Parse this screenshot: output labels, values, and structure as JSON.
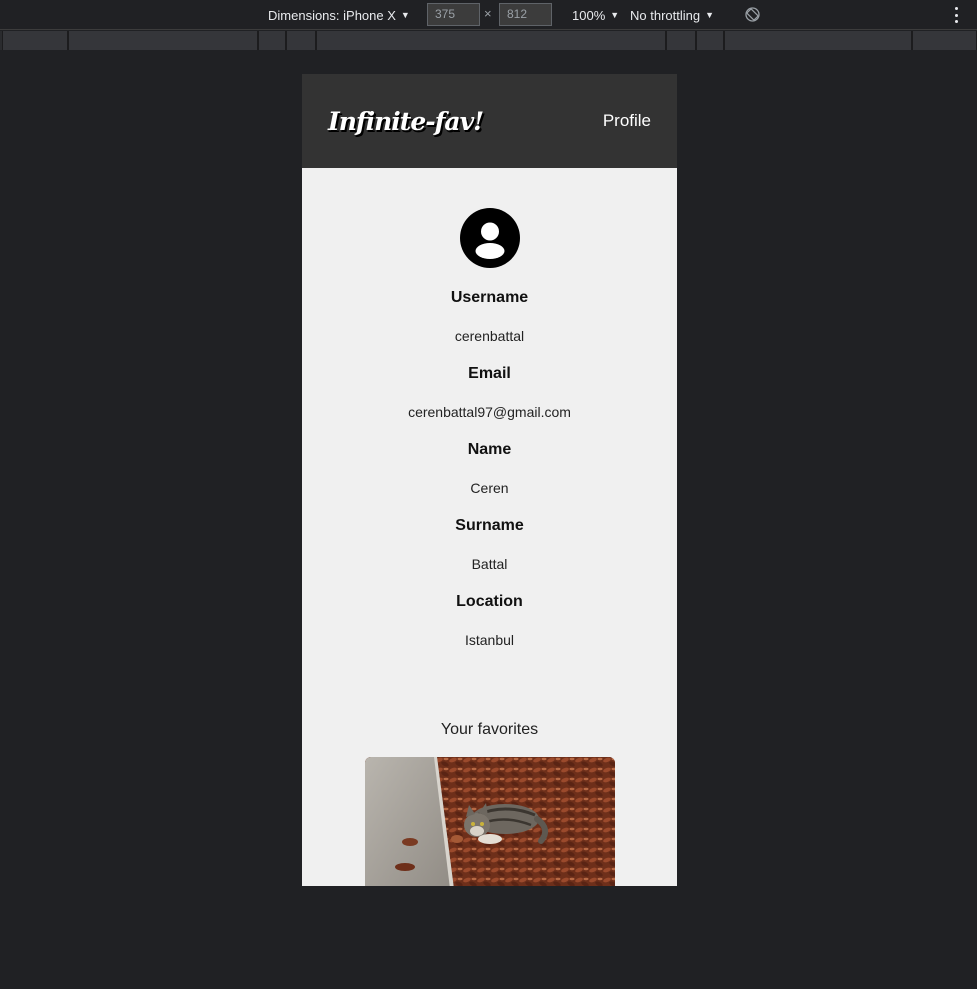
{
  "devtools": {
    "dimensions_label": "Dimensions: iPhone X",
    "width_value": "375",
    "height_value": "812",
    "times_symbol": "×",
    "zoom_label": "100%",
    "throttling_label": "No throttling"
  },
  "app": {
    "logo": "Infinite-fav!",
    "nav_profile": "Profile"
  },
  "profile": {
    "fields": [
      {
        "label": "Username",
        "value": "cerenbattal"
      },
      {
        "label": "Email",
        "value": "cerenbattal97@gmail.com"
      },
      {
        "label": "Name",
        "value": "Ceren"
      },
      {
        "label": "Surname",
        "value": "Battal"
      },
      {
        "label": "Location",
        "value": "Istanbul"
      }
    ]
  },
  "favorites": {
    "title": "Your favorites"
  },
  "colors": {
    "navbar": "#333333",
    "page_bg": "#f0f0f0",
    "devtools_bg": "#202124"
  },
  "icons": [
    "dropdown-caret-icon",
    "rotate-icon",
    "more-options-icon",
    "user-avatar-icon"
  ]
}
